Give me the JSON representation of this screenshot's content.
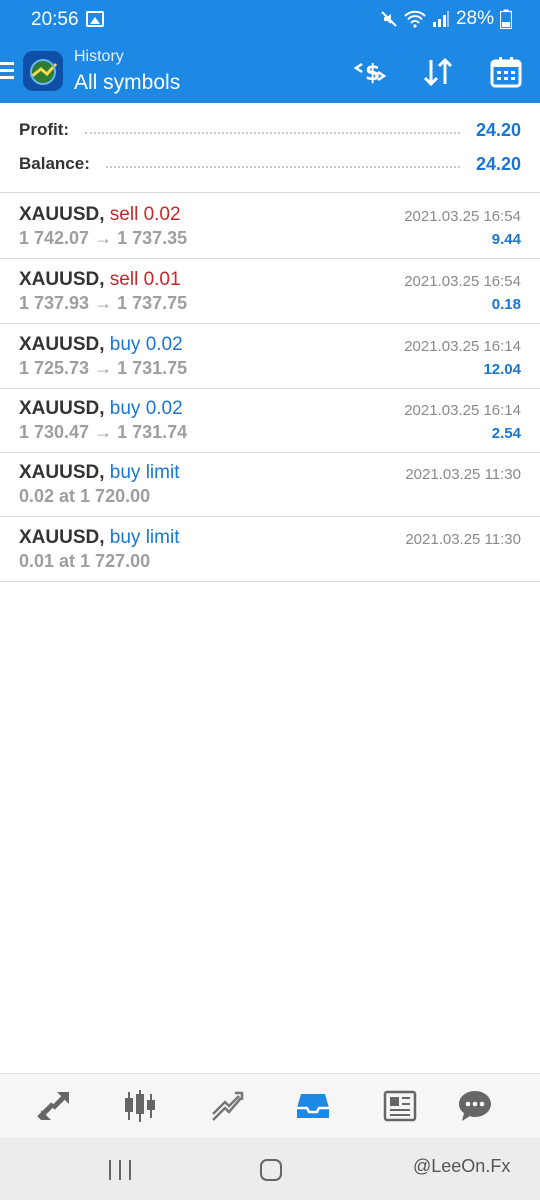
{
  "status": {
    "time": "20:56",
    "battery": "28%",
    "icons": [
      "gallery-icon",
      "mute-icon",
      "wifi-icon",
      "signal-icon",
      "battery-icon"
    ]
  },
  "header": {
    "subtitle": "History",
    "title": "All symbols",
    "actions": [
      "deals-filter-icon",
      "sort-icon",
      "calendar-icon"
    ]
  },
  "summary": {
    "profit_label": "Profit:",
    "profit_value": "24.20",
    "balance_label": "Balance:",
    "balance_value": "24.20"
  },
  "trades": [
    {
      "symbol": "XAUUSD,",
      "action": "sell 0.02",
      "type": "sell",
      "detail": "1 742.07 → 1 737.35",
      "time": "2021.03.25 16:54",
      "profit": "9.44"
    },
    {
      "symbol": "XAUUSD,",
      "action": "sell 0.01",
      "type": "sell",
      "detail": "1 737.93 → 1 737.75",
      "time": "2021.03.25 16:54",
      "profit": "0.18"
    },
    {
      "symbol": "XAUUSD,",
      "action": "buy 0.02",
      "type": "buy",
      "detail": "1 725.73 → 1 731.75",
      "time": "2021.03.25 16:14",
      "profit": "12.04"
    },
    {
      "symbol": "XAUUSD,",
      "action": "buy 0.02",
      "type": "buy",
      "detail": "1 730.47 → 1 731.74",
      "time": "2021.03.25 16:14",
      "profit": "2.54"
    },
    {
      "symbol": "XAUUSD,",
      "action": "buy limit",
      "type": "buy",
      "detail": "0.02 at 1 720.00",
      "time": "2021.03.25 11:30",
      "profit": ""
    },
    {
      "symbol": "XAUUSD,",
      "action": "buy limit",
      "type": "buy",
      "detail": "0.01 at 1 727.00",
      "time": "2021.03.25 11:30",
      "profit": ""
    }
  ],
  "bottom_nav": [
    "quotes-icon",
    "chart-icon",
    "trade-icon",
    "history-icon",
    "news-icon",
    "chat-icon"
  ],
  "active_tab": "history-icon",
  "colors": {
    "primary": "#1e88e5",
    "sell": "#c62828",
    "buy": "#1976d2",
    "muted": "#9e9e9e"
  },
  "watermark": "@LeeOn.Fx"
}
